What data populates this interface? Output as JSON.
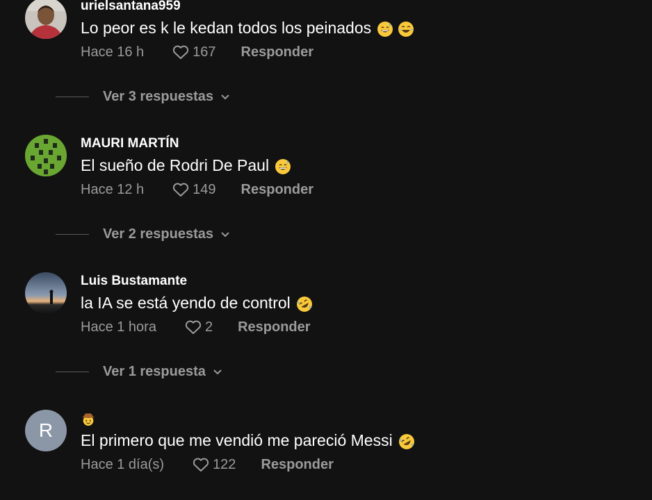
{
  "colors": {
    "background": "#121212",
    "text_primary": "#ffffff",
    "text_secondary": "#9b9b9b",
    "avatar_r_bg": "#8b97a7"
  },
  "comments": [
    {
      "username": "urielsantana959",
      "text": "Lo peor es k le kedan todos los peinados",
      "emojis": [
        "grinning-sweat-emoji",
        "tears-of-joy-emoji"
      ],
      "time": "Hace 16 h",
      "likes": "167",
      "reply_label": "Responder",
      "view_replies_label": "Ver 3 respuestas",
      "avatar": "photo-man-avatar"
    },
    {
      "username": "MAURI MARTÍN",
      "text": "El sueño de Rodri De Paul",
      "emojis": [
        "grinning-sweat-emoji"
      ],
      "time": "Hace 12 h",
      "likes": "149",
      "reply_label": "Responder",
      "view_replies_label": "Ver 2 respuestas",
      "avatar": "football-lineup-avatar"
    },
    {
      "username": "Luis Bustamante",
      "text": "la IA se está yendo de control",
      "emojis": [
        "rolling-laughing-emoji"
      ],
      "time": "Hace 1 hora",
      "likes": "2",
      "reply_label": "Responder",
      "view_replies_label": "Ver 1 respuesta",
      "avatar": "sunset-silhouette-avatar"
    },
    {
      "username_emoji": "cowboy-hat-emoji",
      "text": "El primero que me vendió me pareció Messi",
      "emojis": [
        "rolling-laughing-emoji"
      ],
      "time": "Hace 1 día(s)",
      "likes": "122",
      "reply_label": "Responder",
      "avatar_letter": "R"
    }
  ]
}
